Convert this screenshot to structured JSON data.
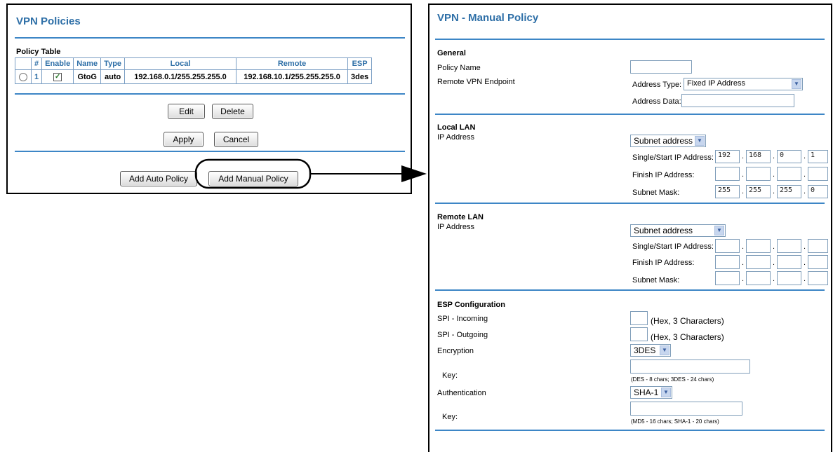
{
  "left": {
    "title": "VPN Policies",
    "table_label": "Policy Table",
    "columns": [
      "#",
      "Enable",
      "Name",
      "Type",
      "Local",
      "Remote",
      "ESP"
    ],
    "rows": [
      {
        "num": "1",
        "enabled": true,
        "name": "GtoG",
        "type": "auto",
        "local": "192.168.0.1/255.255.255.0",
        "remote": "192.168.10.1/255.255.255.0",
        "esp": "3des"
      }
    ],
    "edit_label": "Edit",
    "delete_label": "Delete",
    "apply_label": "Apply",
    "cancel_label": "Cancel",
    "add_auto_label": "Add Auto Policy",
    "add_manual_label": "Add Manual Policy"
  },
  "right": {
    "title": "VPN - Manual Policy",
    "general": {
      "heading": "General",
      "policy_name_label": "Policy Name",
      "policy_name_value": "",
      "remote_endpoint_label": "Remote VPN Endpoint",
      "address_type_label": "Address Type:",
      "address_type_value": "Fixed IP Address",
      "address_data_label": "Address Data:",
      "address_data_value": ""
    },
    "local_lan": {
      "heading": "Local LAN",
      "ip_label": "IP Address",
      "subnet_select": "Subnet address",
      "single_start_label": "Single/Start IP Address:",
      "single_start": [
        "192",
        "168",
        "0",
        "1"
      ],
      "finish_label": "Finish IP Address:",
      "finish": [
        "",
        "",
        "",
        ""
      ],
      "mask_label": "Subnet Mask:",
      "mask": [
        "255",
        "255",
        "255",
        "0"
      ]
    },
    "remote_lan": {
      "heading": "Remote LAN",
      "ip_label": "IP Address",
      "subnet_select": "Subnet address",
      "single_start_label": "Single/Start IP Address:",
      "single_start": [
        "",
        "",
        "",
        ""
      ],
      "finish_label": "Finish IP Address:",
      "finish": [
        "",
        "",
        "",
        ""
      ],
      "mask_label": "Subnet Mask:",
      "mask": [
        "",
        "",
        "",
        ""
      ]
    },
    "esp": {
      "heading": "ESP Configuration",
      "spi_in_label": "SPI - Incoming",
      "spi_in_hint": "(Hex, 3 Characters)",
      "spi_out_label": "SPI - Outgoing",
      "spi_out_hint": "(Hex, 3 Characters)",
      "encryption_label": "Encryption",
      "encryption_value": "3DES",
      "enc_key_label": "Key:",
      "enc_key_hint": "(DES - 8 chars;  3DES - 24 chars)",
      "auth_label": "Authentication",
      "auth_value": "SHA-1",
      "auth_key_label": "Key:",
      "auth_key_hint": "(MD5 - 16 chars;  SHA-1 - 20 chars)"
    }
  },
  "icons": {
    "select_arrow": "chevron-down-icon",
    "check": "check-icon"
  }
}
